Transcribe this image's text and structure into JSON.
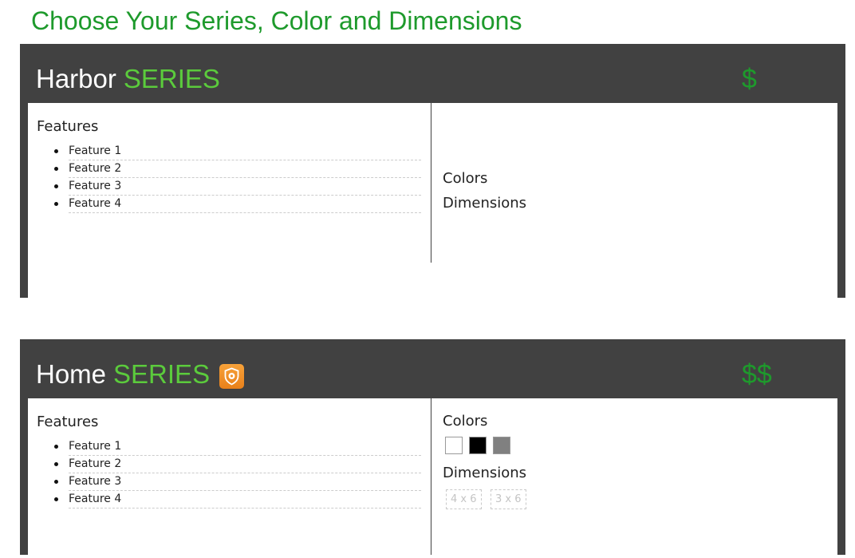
{
  "page": {
    "title": "Choose Your Series, Color and Dimensions"
  },
  "series": [
    {
      "name": "Harbor",
      "series_word": "SERIES",
      "price": "$",
      "features_label": "Features",
      "features": [
        "Feature 1",
        "Feature 2",
        "Feature 3",
        "Feature 4"
      ],
      "colors_label": "Colors",
      "colors": [],
      "dimensions_label": "Dimensions",
      "dimensions": []
    },
    {
      "name": "Home",
      "series_word": "SERIES",
      "badge_icon": "shield-badge-icon",
      "price": "$$",
      "features_label": "Features",
      "features": [
        "Feature 1",
        "Feature 2",
        "Feature 3",
        "Feature 4"
      ],
      "colors_label": "Colors",
      "colors": [
        {
          "name": "white",
          "hex": "#ffffff"
        },
        {
          "name": "black",
          "hex": "#000000"
        },
        {
          "name": "gray",
          "hex": "#808080"
        }
      ],
      "dimensions_label": "Dimensions",
      "dimensions": [
        "4 x 6",
        "3 x 6"
      ]
    }
  ],
  "theme": {
    "title_green": "#1e9a2c",
    "series_green": "#5bcb3c",
    "card_dark": "#414141",
    "badge_orange": "#f39126"
  }
}
